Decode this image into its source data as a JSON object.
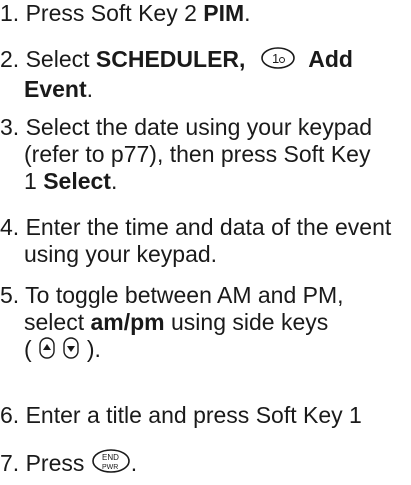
{
  "steps": [
    {
      "num": "1.",
      "text": "Press Soft Key 2 ",
      "bold": "PIM",
      "end": "."
    },
    {
      "num": "2.",
      "text": "Select ",
      "bold1": "SCHEDULER,",
      "key_icon": "one-key-icon",
      "key_label": "1",
      "bold2": "Add",
      "bold3": "Event",
      "end": "."
    },
    {
      "num": "3.",
      "line1": "Select the date using your keypad",
      "line2": "(refer to p77), then press Soft Key",
      "line3a": "1 ",
      "line3b": "Select",
      "end": "."
    },
    {
      "num": "4.",
      "line1": "Enter the time and data of the event",
      "line2": "using your keypad."
    },
    {
      "num": "5.",
      "line1": "To toggle between AM and PM,",
      "line2a": "select ",
      "line2b": "am/pm",
      "line2c": " using side keys",
      "open": "(",
      "close": ").",
      "up_icon": "side-key-up-icon",
      "down_icon": "side-key-down-icon"
    },
    {
      "num": "6.",
      "text": "Enter a title and press Soft Key 1"
    },
    {
      "num": "7.",
      "text": "Press ",
      "key_icon": "end-pwr-key-icon",
      "key_top": "END",
      "key_bottom": "PWR",
      "end": "."
    }
  ]
}
